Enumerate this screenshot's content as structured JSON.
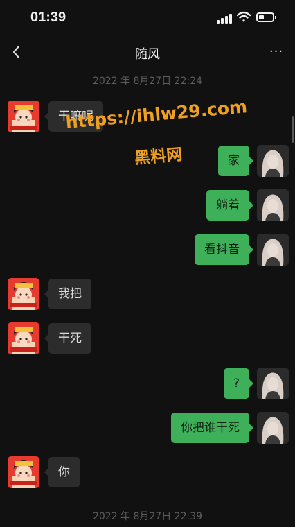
{
  "status_bar": {
    "time": "01:39"
  },
  "header": {
    "title": "随风",
    "more_label": "···"
  },
  "timestamps": [
    "2022 年 8月27日 22:24",
    "2022 年 8月27日 22:39"
  ],
  "watermark": {
    "line1": "https://ihlw29.com",
    "line2": "黑料网"
  },
  "messages": [
    {
      "side": "in",
      "text": "干嘛呢"
    },
    {
      "side": "out",
      "text": "家"
    },
    {
      "side": "out",
      "text": "躺着"
    },
    {
      "side": "out",
      "text": "看抖音"
    },
    {
      "side": "in",
      "text": "我把"
    },
    {
      "side": "in",
      "text": "干死"
    },
    {
      "side": "out",
      "text": "?"
    },
    {
      "side": "out",
      "text": "你把谁干死"
    },
    {
      "side": "in",
      "text": "你"
    }
  ],
  "colors": {
    "background": "#111111",
    "incoming_bubble": "#2c2c2c",
    "outgoing_bubble": "#3fb05a",
    "watermark": "#f0a020"
  }
}
